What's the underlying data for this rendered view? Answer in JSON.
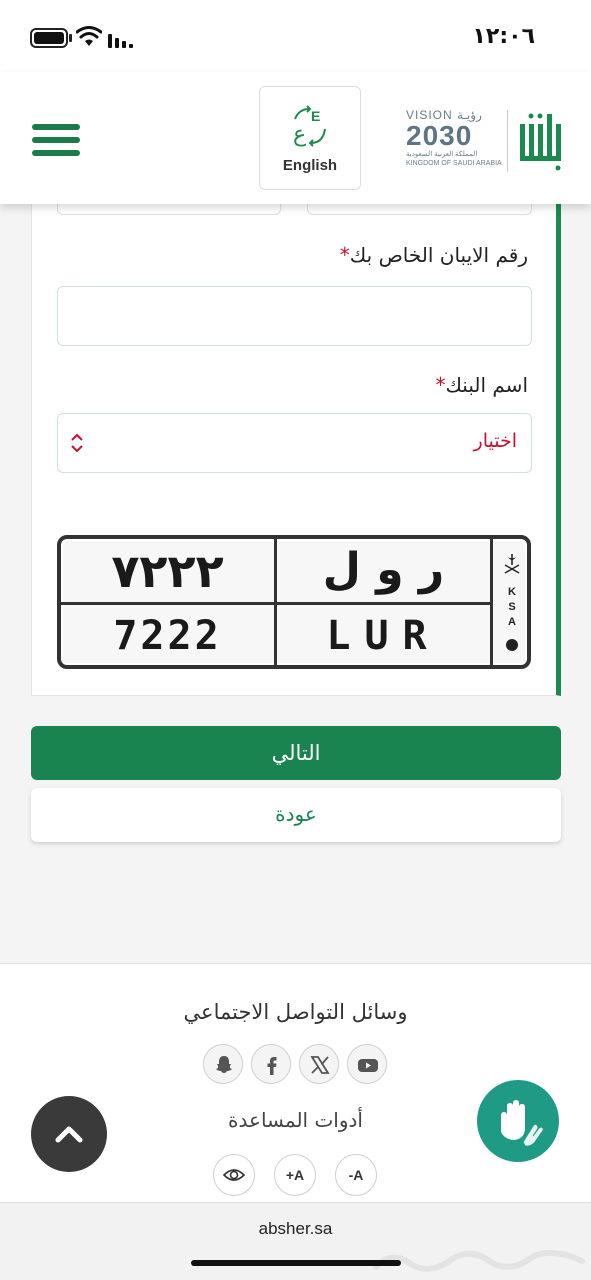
{
  "status_bar": {
    "time": "١٢:٠٦"
  },
  "header": {
    "language_button": "English",
    "vision_logo_top": "VISION رؤيـة",
    "vision_logo_year": "2030",
    "vision_logo_ar": "المملكة العربية السعودية",
    "vision_logo_en": "KINGDOM OF SAUDI ARABIA",
    "brand_logo_text": "أبشر"
  },
  "form": {
    "iban_label": "رقم الايبان الخاص بك",
    "iban_value": "",
    "bank_label": "اسم البنك",
    "bank_select_value": "اختيار",
    "required_mark": "*"
  },
  "plate": {
    "arabic_numbers": "٧٢٢٢",
    "arabic_letters": "ر و ل",
    "english_numbers": "7222",
    "english_letters": "LUR",
    "country_code": [
      "K",
      "S",
      "A"
    ],
    "emblem_caption": "السعودية"
  },
  "actions": {
    "next_label": "التالي",
    "back_label": "عودة"
  },
  "footer": {
    "social_title": "وسائل التواصل الاجتماعي",
    "social_icons": [
      "snapchat-icon",
      "facebook-icon",
      "x-icon",
      "youtube-icon"
    ],
    "tools_title": "أدوات المساعدة",
    "tool_increase": "+A",
    "tool_decrease": "-A",
    "url": "absher.sa"
  },
  "colors": {
    "brand_green": "#1a8450",
    "required_red": "#c8102e",
    "sign_language_teal": "#1f9a84"
  }
}
